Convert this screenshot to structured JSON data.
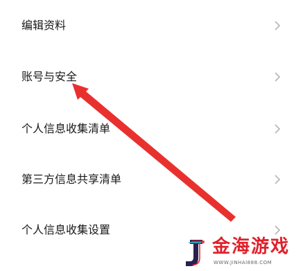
{
  "menu": {
    "items": [
      {
        "label": "编辑资料",
        "icon": "chevron-right-icon"
      },
      {
        "label": "账号与安全",
        "icon": "chevron-right-icon"
      },
      {
        "label": "个人信息收集清单",
        "icon": "chevron-right-icon"
      },
      {
        "label": "第三方信息共享清单",
        "icon": "chevron-right-icon"
      },
      {
        "label": "个人信息收集设置",
        "icon": "chevron-right-icon"
      }
    ]
  },
  "annotation": {
    "type": "arrow",
    "color": "#e8312f",
    "target": "账号与安全"
  },
  "watermark": {
    "brand": "金海游戏",
    "url": "WWW.JINHAI888.COM",
    "brand_color": "#e0202a"
  },
  "colors": {
    "background": "#ffffff",
    "text": "#1a1a1a",
    "chevron": "#b5b5b5"
  }
}
